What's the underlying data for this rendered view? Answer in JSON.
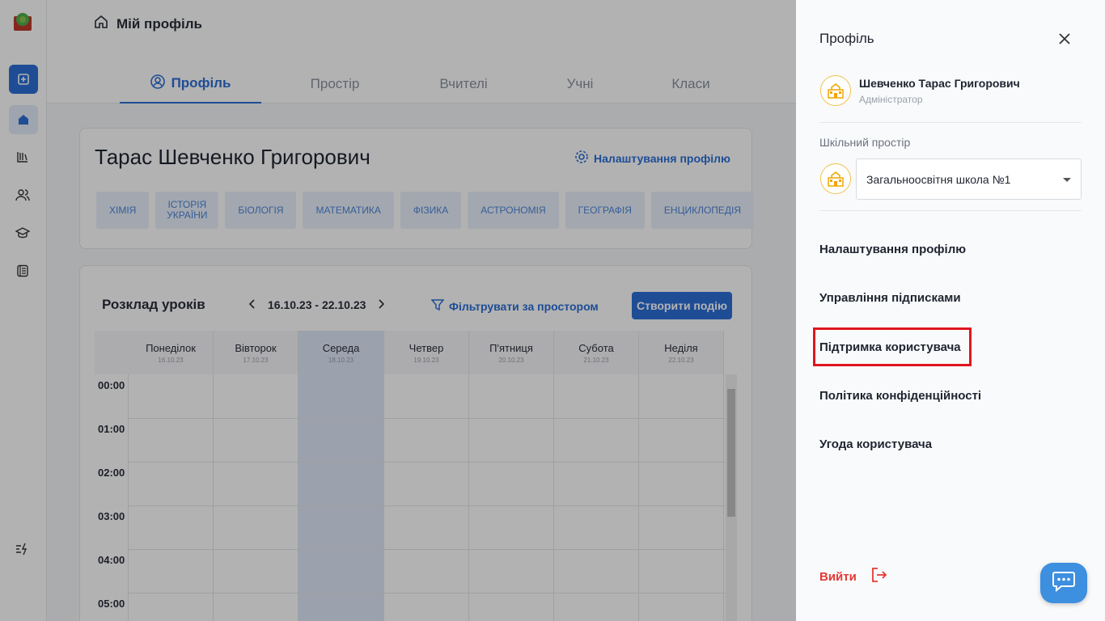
{
  "breadcrumb": {
    "title": "Мій профіль"
  },
  "tabs": [
    {
      "label": "Профіль"
    },
    {
      "label": "Простір"
    },
    {
      "label": "Вчителі"
    },
    {
      "label": "Учні"
    },
    {
      "label": "Класи"
    }
  ],
  "profile": {
    "name": "Тарас Шевченко Григорович",
    "settings_label": "Налаштування профілю",
    "subjects": [
      "ХІМІЯ",
      "ІСТОРІЯ УКРАЇНИ",
      "БІОЛОГІЯ",
      "МАТЕМАТИКА",
      "ФІЗИКА",
      "АСТРОНОМІЯ",
      "ГЕОГРАФІЯ",
      "ЕНЦИКЛОПЕДІЯ"
    ]
  },
  "schedule": {
    "title": "Розклад уроків",
    "week_range": "16.10.23 - 22.10.23",
    "filter_label": "Фільтрувати за простором",
    "create_label": "Створити подію",
    "days": [
      {
        "name": "Понеділок",
        "date": "16.10.23"
      },
      {
        "name": "Вівторок",
        "date": "17.10.23"
      },
      {
        "name": "Середа",
        "date": "18.10.23"
      },
      {
        "name": "Четвер",
        "date": "19.10.23"
      },
      {
        "name": "П'ятниця",
        "date": "20.10.23"
      },
      {
        "name": "Субота",
        "date": "21.10.23"
      },
      {
        "name": "Неділя",
        "date": "22.10.23"
      }
    ],
    "hours": [
      "00:00",
      "01:00",
      "02:00",
      "03:00",
      "04:00",
      "05:00"
    ]
  },
  "drawer": {
    "title": "Профіль",
    "user_name": "Шевченко Тарас Григорович",
    "user_role": "Адміністратор",
    "space_label": "Шкільний простір",
    "space_value": "Загальноосвітня школа №1",
    "menu": [
      "Налаштування профілю",
      "Управління підписками",
      "Підтримка користувача",
      "Політика конфіденційності",
      "Угода користувача"
    ],
    "logout_label": "Вийти"
  },
  "colors": {
    "accent": "#2b6fd6",
    "danger": "#e53935",
    "highlight": "#e0161e",
    "chat": "#3d8fe0"
  }
}
